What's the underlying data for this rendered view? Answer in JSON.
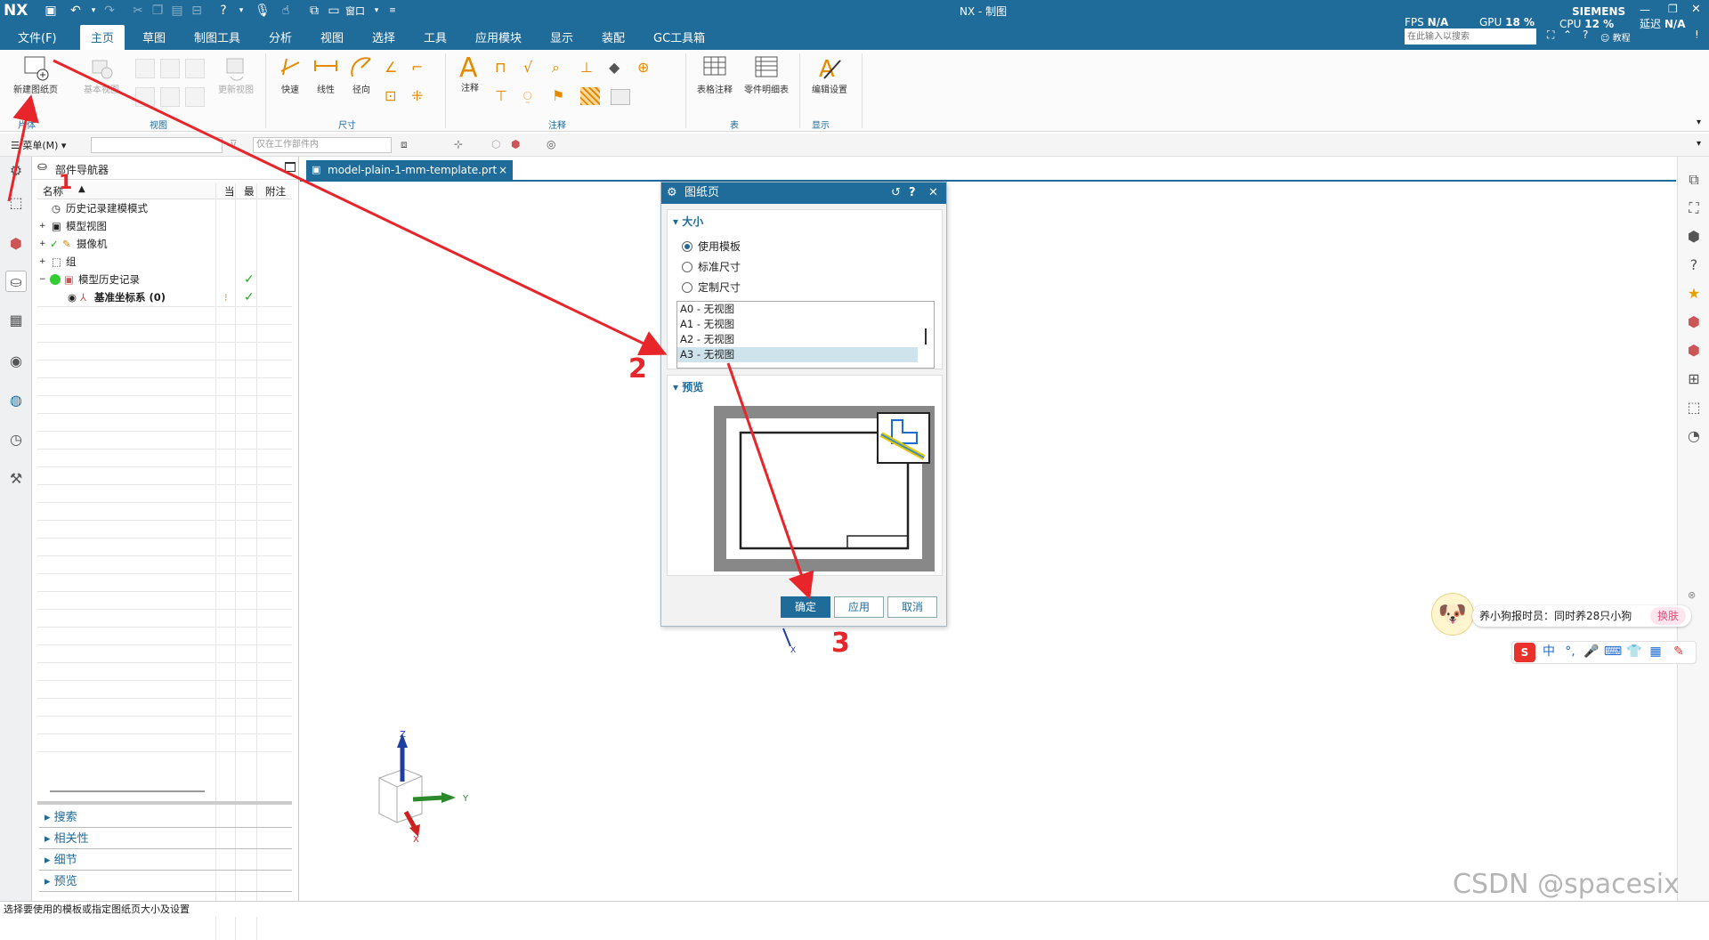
{
  "app": {
    "logo": "NX",
    "window_title": "NX - 制图",
    "brand": "SIEMENS",
    "stats": {
      "fps_label": "FPS",
      "fps_value": "N/A",
      "gpu_label": "GPU",
      "gpu_value": "18 %",
      "cpu_label": "CPU",
      "cpu_value": "12 %",
      "delay_label": "延迟",
      "delay_value": "N/A"
    },
    "window_menu": "窗口",
    "search_placeholder": "在此输入以搜索",
    "tutorial_label": "教程"
  },
  "menu": {
    "file": "文件(F)",
    "items": [
      "主页",
      "草图",
      "制图工具",
      "分析",
      "视图",
      "选择",
      "工具",
      "应用模块",
      "显示",
      "装配",
      "GC工具箱"
    ],
    "active_index": 0
  },
  "ribbon": {
    "new_sheet": "新建图纸页",
    "base_view": "基本视图",
    "update_view": "更新视图",
    "dim_quick": "快速",
    "dim_linear": "线性",
    "dim_radial": "径向",
    "note": "注释",
    "table_note": "表格注释",
    "parts_list": "零件明细表",
    "edit_settings": "编辑设置",
    "groups": {
      "sheet": "片体",
      "view": "视图",
      "dimension": "尺寸",
      "annotation": "注释",
      "table": "表",
      "display": "显示"
    }
  },
  "toolbar2": {
    "menu_label": "菜单(M)",
    "filter_scope": "仅在工作部件内"
  },
  "navigator": {
    "title": "部件导航器",
    "columns": {
      "name": "名称",
      "current": "当",
      "latest": "最",
      "attach": "附注"
    },
    "rows": [
      {
        "label": "历史记录建模模式"
      },
      {
        "label": "模型视图"
      },
      {
        "label": "摄像机"
      },
      {
        "label": "组"
      },
      {
        "label": "模型历史记录"
      },
      {
        "label": "基准坐标系 (0)"
      }
    ],
    "sections": [
      "搜索",
      "相关性",
      "细节",
      "预览"
    ]
  },
  "document_tab": {
    "label": "model-plain-1-mm-template.prt",
    "close": "×"
  },
  "dialog": {
    "title": "图纸页",
    "size_section": "大小",
    "radio_options": [
      "使用模板",
      "标准尺寸",
      "定制尺寸"
    ],
    "selected_radio": 0,
    "templates": [
      "A0 - 无视图",
      "A1 - 无视图",
      "A2 - 无视图",
      "A3 - 无视图"
    ],
    "selected_template": 3,
    "preview_section": "预览",
    "ok": "确定",
    "apply": "应用",
    "cancel": "取消"
  },
  "annotations": {
    "step1": "1",
    "step2": "2",
    "step3": "3",
    "arrow_color": "#e8252a"
  },
  "triad": {
    "z": "Z",
    "y": "Y",
    "x": "X"
  },
  "ime": {
    "news_text": "养小狗报时员：同时养28只小狗",
    "skin_label": "换肤",
    "lang": "中"
  },
  "status_message": "选择要使用的模板或指定图纸页大小及设置",
  "watermark": "CSDN @spacesix"
}
